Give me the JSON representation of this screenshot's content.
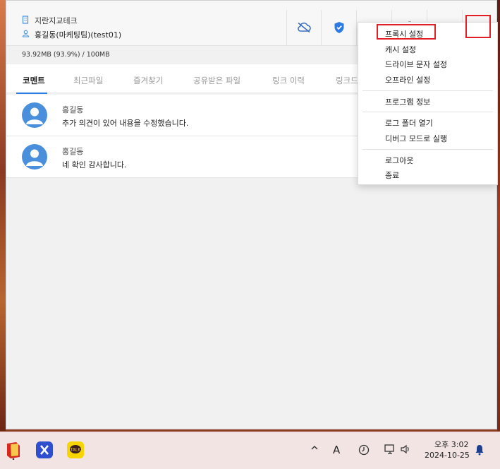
{
  "header": {
    "org_name": "지란지교테크",
    "user_name": "홍길동(마케팅팀)(test01)"
  },
  "storage": {
    "usage_text": "93.92MB (93.9%) / 100MB"
  },
  "tabs": [
    {
      "label": "코멘트",
      "active": true
    },
    {
      "label": "최근파일",
      "active": false
    },
    {
      "label": "즐겨찾기",
      "active": false
    },
    {
      "label": "공유받은 파일",
      "active": false
    },
    {
      "label": "링크 이력",
      "active": false
    },
    {
      "label": "링크드",
      "active": false
    }
  ],
  "comments": [
    {
      "author": "홍길동",
      "text": "추가 의견이 있어 내용을 수정했습니다."
    },
    {
      "author": "홍길동",
      "text": "네 확인 감사합니다."
    }
  ],
  "menu": {
    "group1": [
      "프록시 설정",
      "캐시 설정",
      "드라이브 문자 설정",
      "오프라인 설정"
    ],
    "group2": [
      "프로그램 정보"
    ],
    "group3": [
      "로그 폴더 열기",
      "디버그 모드로 실행"
    ],
    "group4": [
      "로그아웃",
      "종료"
    ]
  },
  "colors": {
    "accent": "#2c7be5",
    "highlight": "#e31e24"
  },
  "taskbar": {
    "ime": "A",
    "time": "오후 3:02",
    "date": "2024-10-25"
  }
}
